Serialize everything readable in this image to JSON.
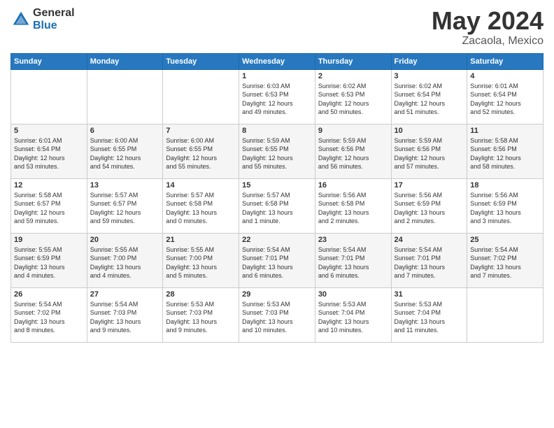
{
  "header": {
    "logo_general": "General",
    "logo_blue": "Blue",
    "title": "May 2024",
    "location": "Zacaola, Mexico"
  },
  "days_of_week": [
    "Sunday",
    "Monday",
    "Tuesday",
    "Wednesday",
    "Thursday",
    "Friday",
    "Saturday"
  ],
  "weeks": [
    [
      {
        "day": "",
        "text": ""
      },
      {
        "day": "",
        "text": ""
      },
      {
        "day": "",
        "text": ""
      },
      {
        "day": "1",
        "text": "Sunrise: 6:03 AM\nSunset: 6:53 PM\nDaylight: 12 hours\nand 49 minutes."
      },
      {
        "day": "2",
        "text": "Sunrise: 6:02 AM\nSunset: 6:53 PM\nDaylight: 12 hours\nand 50 minutes."
      },
      {
        "day": "3",
        "text": "Sunrise: 6:02 AM\nSunset: 6:54 PM\nDaylight: 12 hours\nand 51 minutes."
      },
      {
        "day": "4",
        "text": "Sunrise: 6:01 AM\nSunset: 6:54 PM\nDaylight: 12 hours\nand 52 minutes."
      }
    ],
    [
      {
        "day": "5",
        "text": "Sunrise: 6:01 AM\nSunset: 6:54 PM\nDaylight: 12 hours\nand 53 minutes."
      },
      {
        "day": "6",
        "text": "Sunrise: 6:00 AM\nSunset: 6:55 PM\nDaylight: 12 hours\nand 54 minutes."
      },
      {
        "day": "7",
        "text": "Sunrise: 6:00 AM\nSunset: 6:55 PM\nDaylight: 12 hours\nand 55 minutes."
      },
      {
        "day": "8",
        "text": "Sunrise: 5:59 AM\nSunset: 6:55 PM\nDaylight: 12 hours\nand 55 minutes."
      },
      {
        "day": "9",
        "text": "Sunrise: 5:59 AM\nSunset: 6:56 PM\nDaylight: 12 hours\nand 56 minutes."
      },
      {
        "day": "10",
        "text": "Sunrise: 5:59 AM\nSunset: 6:56 PM\nDaylight: 12 hours\nand 57 minutes."
      },
      {
        "day": "11",
        "text": "Sunrise: 5:58 AM\nSunset: 6:56 PM\nDaylight: 12 hours\nand 58 minutes."
      }
    ],
    [
      {
        "day": "12",
        "text": "Sunrise: 5:58 AM\nSunset: 6:57 PM\nDaylight: 12 hours\nand 59 minutes."
      },
      {
        "day": "13",
        "text": "Sunrise: 5:57 AM\nSunset: 6:57 PM\nDaylight: 12 hours\nand 59 minutes."
      },
      {
        "day": "14",
        "text": "Sunrise: 5:57 AM\nSunset: 6:58 PM\nDaylight: 13 hours\nand 0 minutes."
      },
      {
        "day": "15",
        "text": "Sunrise: 5:57 AM\nSunset: 6:58 PM\nDaylight: 13 hours\nand 1 minute."
      },
      {
        "day": "16",
        "text": "Sunrise: 5:56 AM\nSunset: 6:58 PM\nDaylight: 13 hours\nand 2 minutes."
      },
      {
        "day": "17",
        "text": "Sunrise: 5:56 AM\nSunset: 6:59 PM\nDaylight: 13 hours\nand 2 minutes."
      },
      {
        "day": "18",
        "text": "Sunrise: 5:56 AM\nSunset: 6:59 PM\nDaylight: 13 hours\nand 3 minutes."
      }
    ],
    [
      {
        "day": "19",
        "text": "Sunrise: 5:55 AM\nSunset: 6:59 PM\nDaylight: 13 hours\nand 4 minutes."
      },
      {
        "day": "20",
        "text": "Sunrise: 5:55 AM\nSunset: 7:00 PM\nDaylight: 13 hours\nand 4 minutes."
      },
      {
        "day": "21",
        "text": "Sunrise: 5:55 AM\nSunset: 7:00 PM\nDaylight: 13 hours\nand 5 minutes."
      },
      {
        "day": "22",
        "text": "Sunrise: 5:54 AM\nSunset: 7:01 PM\nDaylight: 13 hours\nand 6 minutes."
      },
      {
        "day": "23",
        "text": "Sunrise: 5:54 AM\nSunset: 7:01 PM\nDaylight: 13 hours\nand 6 minutes."
      },
      {
        "day": "24",
        "text": "Sunrise: 5:54 AM\nSunset: 7:01 PM\nDaylight: 13 hours\nand 7 minutes."
      },
      {
        "day": "25",
        "text": "Sunrise: 5:54 AM\nSunset: 7:02 PM\nDaylight: 13 hours\nand 7 minutes."
      }
    ],
    [
      {
        "day": "26",
        "text": "Sunrise: 5:54 AM\nSunset: 7:02 PM\nDaylight: 13 hours\nand 8 minutes."
      },
      {
        "day": "27",
        "text": "Sunrise: 5:54 AM\nSunset: 7:03 PM\nDaylight: 13 hours\nand 9 minutes."
      },
      {
        "day": "28",
        "text": "Sunrise: 5:53 AM\nSunset: 7:03 PM\nDaylight: 13 hours\nand 9 minutes."
      },
      {
        "day": "29",
        "text": "Sunrise: 5:53 AM\nSunset: 7:03 PM\nDaylight: 13 hours\nand 10 minutes."
      },
      {
        "day": "30",
        "text": "Sunrise: 5:53 AM\nSunset: 7:04 PM\nDaylight: 13 hours\nand 10 minutes."
      },
      {
        "day": "31",
        "text": "Sunrise: 5:53 AM\nSunset: 7:04 PM\nDaylight: 13 hours\nand 11 minutes."
      },
      {
        "day": "",
        "text": ""
      }
    ]
  ]
}
